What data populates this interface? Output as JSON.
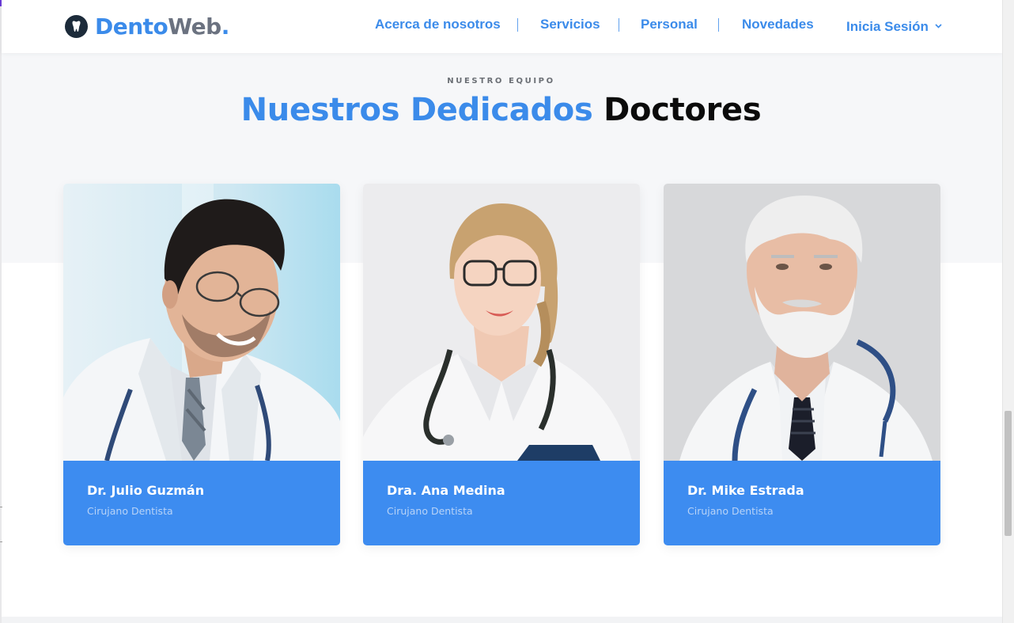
{
  "brand": {
    "name_part1": "Dento",
    "name_part2": "Web",
    "name_dot": ".",
    "icon": "tooth-icon"
  },
  "nav": {
    "items": [
      {
        "label": "Acerca de nosotros"
      },
      {
        "label": "Servicios"
      },
      {
        "label": "Personal"
      },
      {
        "label": "Novedades"
      },
      {
        "label": "Inicia Sesión",
        "icon": "chevron-down-icon"
      }
    ],
    "separator": "|"
  },
  "section": {
    "eyebrow": "NUESTRO EQUIPO",
    "title_highlight": "Nuestros Dedicados",
    "title_rest": "Doctores"
  },
  "doctors": [
    {
      "name": "Dr. Julio Guzmán",
      "role": "Cirujano Dentista"
    },
    {
      "name": "Dra. Ana Medina",
      "role": "Cirujano Dentista"
    },
    {
      "name": "Dr. Mike Estrada",
      "role": "Cirujano Dentista"
    }
  ],
  "colors": {
    "accent": "#3b8bea",
    "card_footer": "#3d8cf0",
    "heading_dark": "#0b0b0b",
    "section_bg": "#f6f7f9"
  }
}
